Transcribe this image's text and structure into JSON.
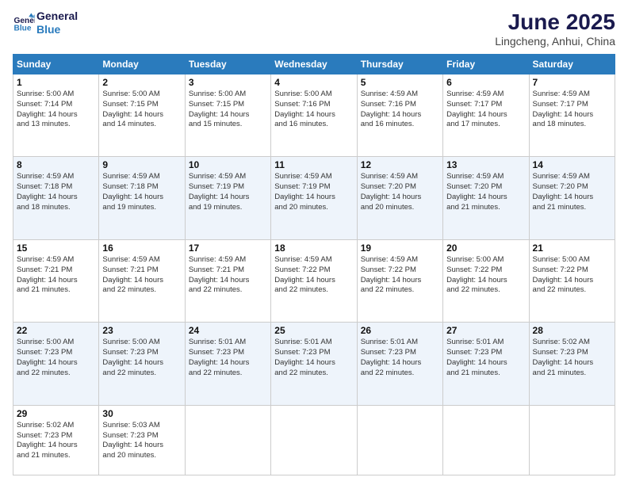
{
  "header": {
    "logo_line1": "General",
    "logo_line2": "Blue",
    "title": "June 2025",
    "subtitle": "Lingcheng, Anhui, China"
  },
  "columns": [
    "Sunday",
    "Monday",
    "Tuesday",
    "Wednesday",
    "Thursday",
    "Friday",
    "Saturday"
  ],
  "weeks": [
    {
      "stripe": false,
      "days": [
        {
          "num": "1",
          "info": "Sunrise: 5:00 AM\nSunset: 7:14 PM\nDaylight: 14 hours\nand 13 minutes."
        },
        {
          "num": "2",
          "info": "Sunrise: 5:00 AM\nSunset: 7:15 PM\nDaylight: 14 hours\nand 14 minutes."
        },
        {
          "num": "3",
          "info": "Sunrise: 5:00 AM\nSunset: 7:15 PM\nDaylight: 14 hours\nand 15 minutes."
        },
        {
          "num": "4",
          "info": "Sunrise: 5:00 AM\nSunset: 7:16 PM\nDaylight: 14 hours\nand 16 minutes."
        },
        {
          "num": "5",
          "info": "Sunrise: 4:59 AM\nSunset: 7:16 PM\nDaylight: 14 hours\nand 16 minutes."
        },
        {
          "num": "6",
          "info": "Sunrise: 4:59 AM\nSunset: 7:17 PM\nDaylight: 14 hours\nand 17 minutes."
        },
        {
          "num": "7",
          "info": "Sunrise: 4:59 AM\nSunset: 7:17 PM\nDaylight: 14 hours\nand 18 minutes."
        }
      ]
    },
    {
      "stripe": true,
      "days": [
        {
          "num": "8",
          "info": "Sunrise: 4:59 AM\nSunset: 7:18 PM\nDaylight: 14 hours\nand 18 minutes."
        },
        {
          "num": "9",
          "info": "Sunrise: 4:59 AM\nSunset: 7:18 PM\nDaylight: 14 hours\nand 19 minutes."
        },
        {
          "num": "10",
          "info": "Sunrise: 4:59 AM\nSunset: 7:19 PM\nDaylight: 14 hours\nand 19 minutes."
        },
        {
          "num": "11",
          "info": "Sunrise: 4:59 AM\nSunset: 7:19 PM\nDaylight: 14 hours\nand 20 minutes."
        },
        {
          "num": "12",
          "info": "Sunrise: 4:59 AM\nSunset: 7:20 PM\nDaylight: 14 hours\nand 20 minutes."
        },
        {
          "num": "13",
          "info": "Sunrise: 4:59 AM\nSunset: 7:20 PM\nDaylight: 14 hours\nand 21 minutes."
        },
        {
          "num": "14",
          "info": "Sunrise: 4:59 AM\nSunset: 7:20 PM\nDaylight: 14 hours\nand 21 minutes."
        }
      ]
    },
    {
      "stripe": false,
      "days": [
        {
          "num": "15",
          "info": "Sunrise: 4:59 AM\nSunset: 7:21 PM\nDaylight: 14 hours\nand 21 minutes."
        },
        {
          "num": "16",
          "info": "Sunrise: 4:59 AM\nSunset: 7:21 PM\nDaylight: 14 hours\nand 22 minutes."
        },
        {
          "num": "17",
          "info": "Sunrise: 4:59 AM\nSunset: 7:21 PM\nDaylight: 14 hours\nand 22 minutes."
        },
        {
          "num": "18",
          "info": "Sunrise: 4:59 AM\nSunset: 7:22 PM\nDaylight: 14 hours\nand 22 minutes."
        },
        {
          "num": "19",
          "info": "Sunrise: 4:59 AM\nSunset: 7:22 PM\nDaylight: 14 hours\nand 22 minutes."
        },
        {
          "num": "20",
          "info": "Sunrise: 5:00 AM\nSunset: 7:22 PM\nDaylight: 14 hours\nand 22 minutes."
        },
        {
          "num": "21",
          "info": "Sunrise: 5:00 AM\nSunset: 7:22 PM\nDaylight: 14 hours\nand 22 minutes."
        }
      ]
    },
    {
      "stripe": true,
      "days": [
        {
          "num": "22",
          "info": "Sunrise: 5:00 AM\nSunset: 7:23 PM\nDaylight: 14 hours\nand 22 minutes."
        },
        {
          "num": "23",
          "info": "Sunrise: 5:00 AM\nSunset: 7:23 PM\nDaylight: 14 hours\nand 22 minutes."
        },
        {
          "num": "24",
          "info": "Sunrise: 5:01 AM\nSunset: 7:23 PM\nDaylight: 14 hours\nand 22 minutes."
        },
        {
          "num": "25",
          "info": "Sunrise: 5:01 AM\nSunset: 7:23 PM\nDaylight: 14 hours\nand 22 minutes."
        },
        {
          "num": "26",
          "info": "Sunrise: 5:01 AM\nSunset: 7:23 PM\nDaylight: 14 hours\nand 22 minutes."
        },
        {
          "num": "27",
          "info": "Sunrise: 5:01 AM\nSunset: 7:23 PM\nDaylight: 14 hours\nand 21 minutes."
        },
        {
          "num": "28",
          "info": "Sunrise: 5:02 AM\nSunset: 7:23 PM\nDaylight: 14 hours\nand 21 minutes."
        }
      ]
    },
    {
      "stripe": false,
      "days": [
        {
          "num": "29",
          "info": "Sunrise: 5:02 AM\nSunset: 7:23 PM\nDaylight: 14 hours\nand 21 minutes."
        },
        {
          "num": "30",
          "info": "Sunrise: 5:03 AM\nSunset: 7:23 PM\nDaylight: 14 hours\nand 20 minutes."
        },
        {
          "num": "",
          "info": ""
        },
        {
          "num": "",
          "info": ""
        },
        {
          "num": "",
          "info": ""
        },
        {
          "num": "",
          "info": ""
        },
        {
          "num": "",
          "info": ""
        }
      ]
    }
  ]
}
